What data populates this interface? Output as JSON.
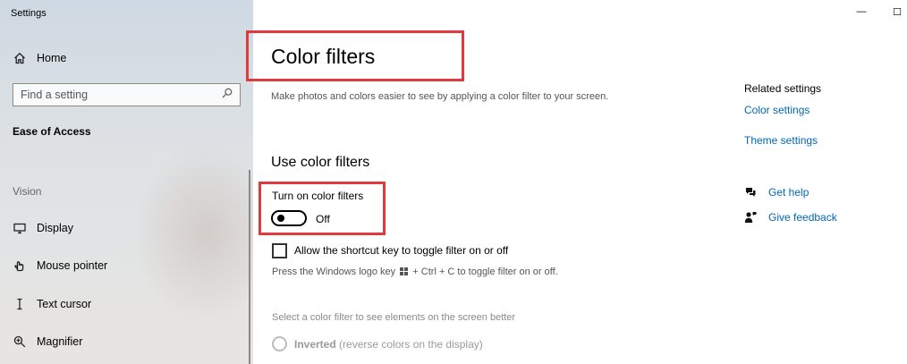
{
  "window": {
    "title": "Settings",
    "minimize_glyph": "—",
    "maximize_glyph": "☐"
  },
  "sidebar": {
    "home_label": "Home",
    "search_placeholder": "Find a setting",
    "section_title": "Ease of Access",
    "group_label": "Vision",
    "items": [
      {
        "label": "Display",
        "icon": "display-icon"
      },
      {
        "label": "Mouse pointer",
        "icon": "mouse-pointer-icon"
      },
      {
        "label": "Text cursor",
        "icon": "text-cursor-icon"
      },
      {
        "label": "Magnifier",
        "icon": "magnifier-icon"
      }
    ]
  },
  "main": {
    "title": "Color filters",
    "description": "Make photos and colors easier to see by applying a color filter to your screen.",
    "subtitle": "Use color filters",
    "toggle_label": "Turn on color filters",
    "toggle_state": "Off",
    "shortcut_checkbox_label": "Allow the shortcut key to toggle filter on or off",
    "hint_before": "Press the Windows logo key",
    "hint_after": "+ Ctrl + C to toggle filter on or off.",
    "select_label": "Select a color filter to see elements on the screen better",
    "radio_label_bold": "Inverted",
    "radio_label_rest": " (reverse colors on the display)"
  },
  "related": {
    "title": "Related settings",
    "links": [
      "Color settings",
      "Theme settings"
    ],
    "get_help": "Get help",
    "give_feedback": "Give feedback"
  },
  "colors": {
    "accent": "#0067b8",
    "highlight": "#e0393e"
  }
}
